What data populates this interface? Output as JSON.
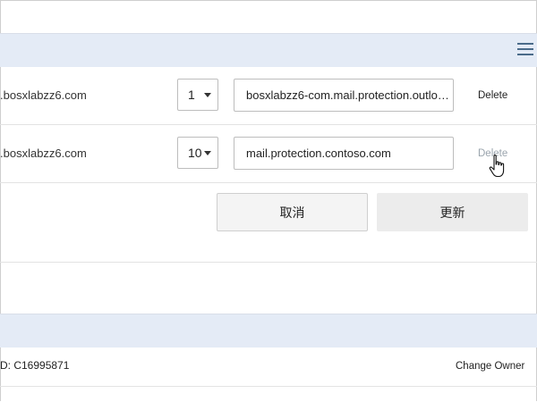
{
  "records": [
    {
      "domain": ".bosxlabzz6.com",
      "priority": "1",
      "target": "bosxlabzz6-com.mail.protection.outlook.com",
      "delete_label": "Delete"
    },
    {
      "domain": ".bosxlabzz6.com",
      "priority": "10",
      "target": "mail.protection.contoso.com",
      "delete_label": "Delete"
    }
  ],
  "actions": {
    "cancel_label": "取消",
    "update_label": "更新"
  },
  "footer": {
    "id_text": "D: C16995871",
    "change_owner_label": "Change Owner"
  },
  "icons": {
    "menu": "hamburger-menu-icon",
    "caret": "chevron-down-icon",
    "cursor": "hand-pointer-icon"
  },
  "colors": {
    "header_bar": "#e4ebf6",
    "muted_link": "#9aa4ad",
    "menu_icon": "#4a6b8a"
  }
}
